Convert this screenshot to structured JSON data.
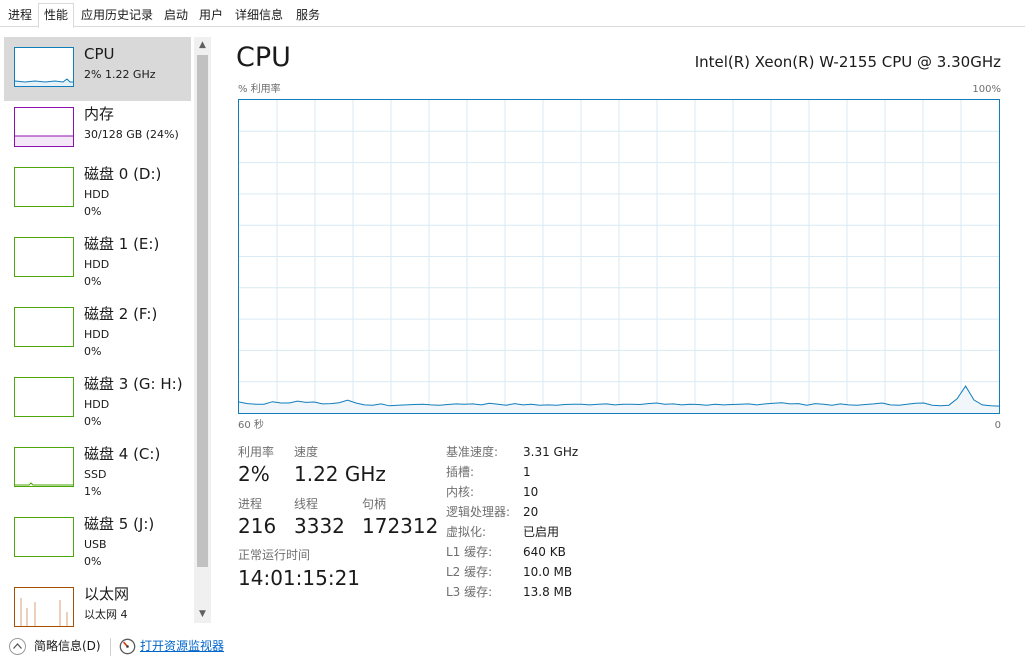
{
  "tabs": [
    {
      "label": "进程"
    },
    {
      "label": "性能",
      "active": true
    },
    {
      "label": "应用历史记录"
    },
    {
      "label": "启动"
    },
    {
      "label": "用户"
    },
    {
      "label": "详细信息"
    },
    {
      "label": "服务"
    }
  ],
  "sidebar": {
    "items": [
      {
        "title": "CPU",
        "sub1": "2% 1.22 GHz",
        "sub2": "",
        "color": "#117dbb",
        "selected": true
      },
      {
        "title": "内存",
        "sub1": "30/128 GB (24%)",
        "sub2": "",
        "color": "#8b12ae"
      },
      {
        "title": "磁盘 0 (D:)",
        "sub1": "HDD",
        "sub2": "0%",
        "color": "#4da60c"
      },
      {
        "title": "磁盘 1 (E:)",
        "sub1": "HDD",
        "sub2": "0%",
        "color": "#4da60c"
      },
      {
        "title": "磁盘 2 (F:)",
        "sub1": "HDD",
        "sub2": "0%",
        "color": "#4da60c"
      },
      {
        "title": "磁盘 3 (G: H:)",
        "sub1": "HDD",
        "sub2": "0%",
        "color": "#4da60c"
      },
      {
        "title": "磁盘 4 (C:)",
        "sub1": "SSD",
        "sub2": "1%",
        "color": "#4da60c"
      },
      {
        "title": "磁盘 5 (J:)",
        "sub1": "USB",
        "sub2": "0%",
        "color": "#4da60c"
      },
      {
        "title": "以太网",
        "sub1": "以太网 4",
        "sub2": "",
        "color": "#a74f01"
      }
    ]
  },
  "main": {
    "title": "CPU",
    "cpu_model": "Intel(R) Xeon(R) W-2155 CPU @ 3.30GHz",
    "graph_label": "% 利用率",
    "graph_max": "100%",
    "time_span": "60 秒",
    "time_end": "0",
    "colors": {
      "graph_line": "#117dbb",
      "graph_fill": "#f1f6fa",
      "grid": "#d9eaf4"
    },
    "usage_history": [
      3.5,
      3,
      2.8,
      2.8,
      3.6,
      3.2,
      3.2,
      3.8,
      3.4,
      3.5,
      2.9,
      3,
      3.3,
      4.1,
      3.2,
      2.6,
      2.5,
      2.9,
      2.3,
      2.5,
      2.6,
      2.7,
      2.8,
      2.6,
      2.5,
      2.7,
      2.9,
      2.8,
      2.9,
      2.6,
      3.1,
      2.8,
      2.5,
      3,
      2.6,
      2.8,
      2.5,
      2.6,
      2.5,
      2.7,
      2.8,
      2.8,
      2.6,
      2.8,
      2.9,
      2.6,
      2.8,
      2.8,
      2.7,
      3,
      3.2,
      2.8,
      2.9,
      2.6,
      2.8,
      2.7,
      2.5,
      2.8,
      2.6,
      2.7,
      2.8,
      2.9,
      2.6,
      2.9,
      3.1,
      3.3,
      2.9,
      3,
      2.5,
      3,
      2.8,
      2.5,
      2.9,
      2.6,
      2.5,
      2.7,
      2.9,
      3.2,
      2.6,
      2.5,
      2.8,
      3.1,
      3.2,
      2.5,
      2.3,
      2.5,
      4.6,
      8.6,
      4.2,
      2.6,
      2.3,
      2.2
    ],
    "stats": {
      "util_label": "利用率",
      "util_value": "2%",
      "speed_label": "速度",
      "speed_value": "1.22 GHz",
      "proc_label": "进程",
      "proc_value": "216",
      "thread_label": "线程",
      "thread_value": "3332",
      "handle_label": "句柄",
      "handle_value": "172312",
      "uptime_label": "正常运行时间",
      "uptime_value": "14:01:15:21"
    },
    "specs": [
      {
        "label": "基准速度:",
        "value": "3.31 GHz"
      },
      {
        "label": "插槽:",
        "value": "1"
      },
      {
        "label": "内核:",
        "value": "10"
      },
      {
        "label": "逻辑处理器:",
        "value": "20"
      },
      {
        "label": "虚拟化:",
        "value": "已启用"
      },
      {
        "label": "L1 缓存:",
        "value": "640 KB"
      },
      {
        "label": "L2 缓存:",
        "value": "10.0 MB"
      },
      {
        "label": "L3 缓存:",
        "value": "13.8 MB"
      }
    ]
  },
  "footer": {
    "summary_label": "简略信息(D)",
    "monitor_link": "打开资源监视器"
  }
}
